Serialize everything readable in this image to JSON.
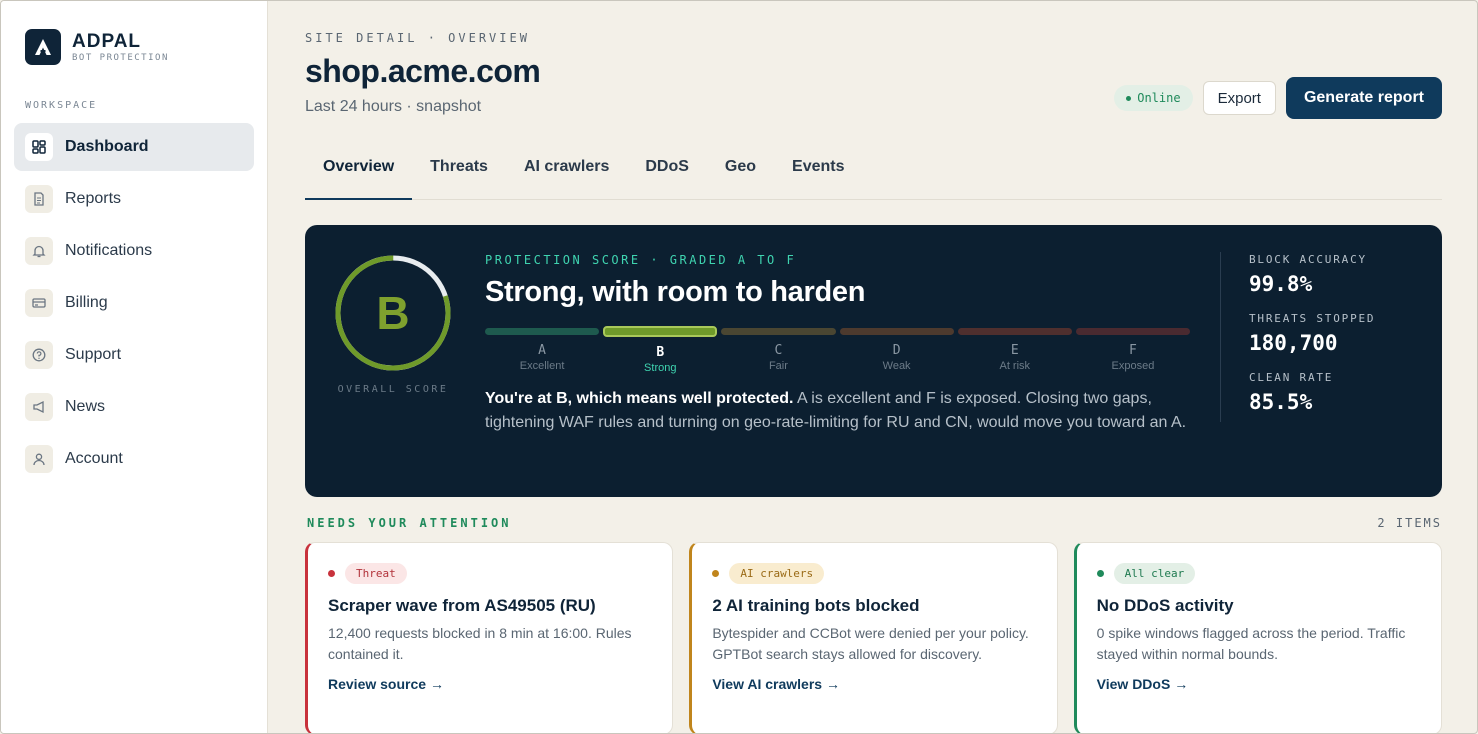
{
  "brand": {
    "name": "ADPAL",
    "sub": "BOT PROTECTION"
  },
  "sidebar": {
    "section_label": "WORKSPACE",
    "items": [
      {
        "label": "Dashboard",
        "icon": "dashboard-icon",
        "active": true
      },
      {
        "label": "Reports",
        "icon": "document-icon"
      },
      {
        "label": "Notifications",
        "icon": "bell-icon"
      },
      {
        "label": "Billing",
        "icon": "credit-card-icon"
      },
      {
        "label": "Support",
        "icon": "help-icon"
      },
      {
        "label": "News",
        "icon": "megaphone-icon"
      },
      {
        "label": "Account",
        "icon": "user-icon"
      }
    ]
  },
  "header": {
    "eyebrow": "SITE DETAIL · OVERVIEW",
    "title": "shop.acme.com",
    "subtitle": "Last 24 hours · snapshot",
    "status": "Online",
    "export_label": "Export",
    "primary_label": "Generate report"
  },
  "tabs": [
    "Overview",
    "Threats",
    "AI crawlers",
    "DDoS",
    "Geo",
    "Events"
  ],
  "score": {
    "grade": "B",
    "ring_fill": 0.8,
    "overall_label": "OVERALL SCORE",
    "eyebrow": "PROTECTION SCORE · GRADED A TO F",
    "headline": "Strong, with room to harden",
    "grades": [
      {
        "letter": "A",
        "name": "Excellent",
        "color": "#1e5a4e"
      },
      {
        "letter": "B",
        "name": "Strong",
        "color": "#6f9a2a",
        "selected": true
      },
      {
        "letter": "C",
        "name": "Fair",
        "color": "#4a4632"
      },
      {
        "letter": "D",
        "name": "Weak",
        "color": "#4d3a2e"
      },
      {
        "letter": "E",
        "name": "At risk",
        "color": "#4f2f2e"
      },
      {
        "letter": "F",
        "name": "Exposed",
        "color": "#4a2a30"
      }
    ],
    "desc_bold": "You're at B, which means well protected.",
    "desc_rest": " A is excellent and F is exposed. Closing two gaps, tightening WAF rules and turning on geo-rate-limiting for RU and CN, would move you toward an A."
  },
  "stats": [
    {
      "label": "BLOCK ACCURACY",
      "value": "99.8%"
    },
    {
      "label": "THREATS STOPPED",
      "value": "180,700"
    },
    {
      "label": "CLEAN RATE",
      "value": "85.5%"
    }
  ],
  "attention": {
    "title": "NEEDS YOUR ATTENTION",
    "count": "2 ITEMS",
    "cards": [
      {
        "tag": "Threat",
        "title": "Scraper wave from AS49505 (RU)",
        "text": "12,400 requests blocked in 8 min at 16:00. Rules contained it.",
        "link": "Review source →"
      },
      {
        "tag": "AI crawlers",
        "title": "2 AI training bots blocked",
        "text": "Bytespider and CCBot were denied per your policy. GPTBot search stays allowed for discovery.",
        "link": "View AI crawlers →"
      },
      {
        "tag": "All clear",
        "title": "No DDoS activity",
        "text": "0 spike windows flagged across the period. Traffic stayed within normal bounds.",
        "link": "View DDoS →"
      }
    ]
  }
}
